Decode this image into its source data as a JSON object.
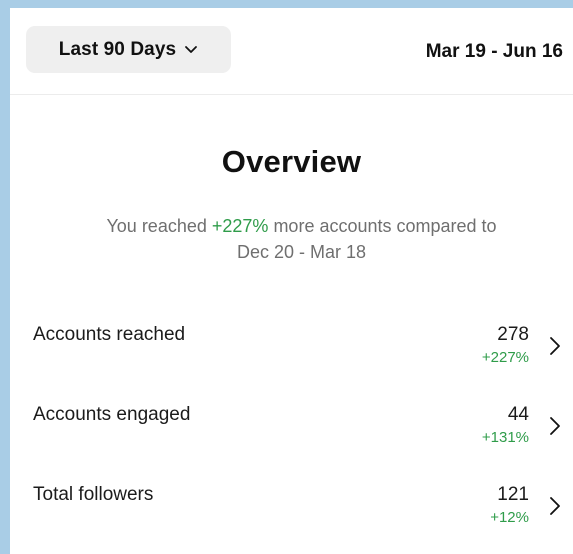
{
  "header": {
    "range_button": "Last 90 Days",
    "date_range": "Mar 19 - Jun 16"
  },
  "overview": {
    "title": "Overview",
    "summary_prefix": "You reached ",
    "summary_highlight": "+227%",
    "summary_suffix": " more accounts compared to",
    "summary_line2": "Dec 20 - Mar 18"
  },
  "metrics": [
    {
      "label": "Accounts reached",
      "value": "278",
      "change": "+227%"
    },
    {
      "label": "Accounts engaged",
      "value": "44",
      "change": "+131%"
    },
    {
      "label": "Total followers",
      "value": "121",
      "change": "+12%"
    }
  ],
  "colors": {
    "accent_green": "#2f9c4a",
    "page_background": "#a9cde6",
    "button_background": "#efefef"
  },
  "icons": {
    "dropdown": "chevron-down-icon",
    "row": "chevron-right-icon"
  }
}
